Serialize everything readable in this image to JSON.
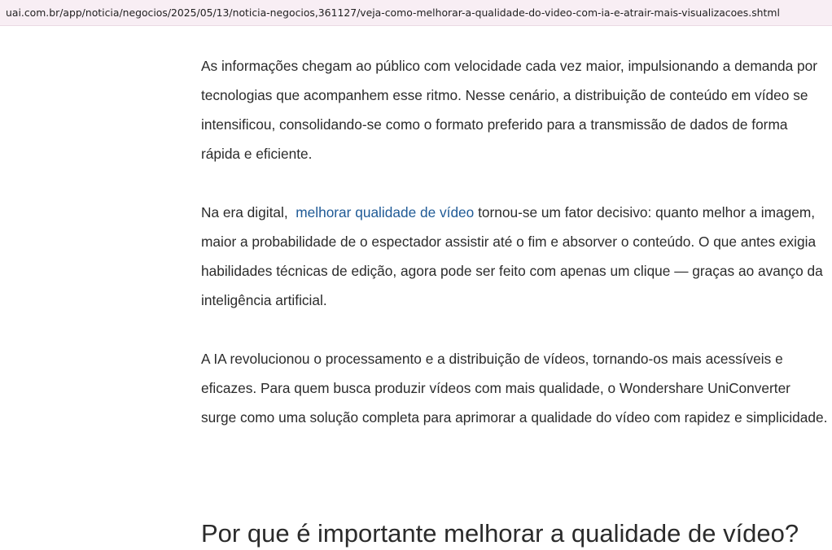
{
  "browser": {
    "url": "uai.com.br/app/noticia/negocios/2025/05/13/noticia-negocios,361127/veja-como-melhorar-a-qualidade-do-video-com-ia-e-atrair-mais-visualizacoes.shtml"
  },
  "article": {
    "paragraph_1": "As informações chegam ao público com velocidade cada vez maior, impulsionando a demanda por tecnologias que acompanhem esse ritmo. Nesse cenário, a distribuição de conteúdo em vídeo se intensificou, consolidando-se como o formato preferido para a transmissão de dados de forma rápida e eficiente.",
    "paragraph_2_before": "Na era digital,  ",
    "paragraph_2_link": "melhorar qualidade de vídeo",
    "paragraph_2_after": " tornou-se um fator decisivo: quanto melhor a imagem, maior a probabilidade de o espectador assistir até o fim e absorver o conteúdo. O que antes exigia habilidades técnicas de edição, agora pode ser feito com apenas um clique — graças ao avanço da inteligência artificial.",
    "paragraph_3": "A IA revolucionou o processamento e a distribuição de vídeos, tornando-os mais acessíveis e eficazes. Para quem busca produzir vídeos com mais qualidade, o Wondershare UniConverter surge como uma solução completa para aprimorar a qualidade do vídeo com rapidez e simplicidade.",
    "heading": "Por que é importante melhorar a qualidade de vídeo?"
  },
  "colors": {
    "url_bar_bg": "#f8eef4",
    "text": "#2b2b2b",
    "link": "#1f5a96"
  }
}
